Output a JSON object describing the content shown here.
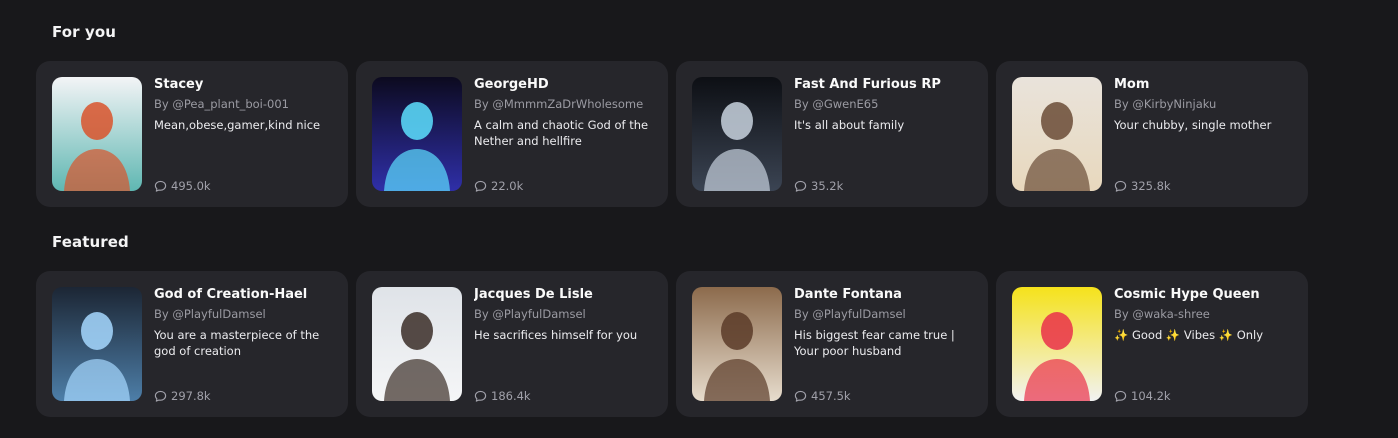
{
  "sections": [
    {
      "title": "For you",
      "cards": [
        {
          "name": "Stacey",
          "author": "By @Pea_plant_boi-001",
          "description": "Mean,obese,gamer,kind nice",
          "chats": "495.0k",
          "thumb_colors": [
            "#f3f4f6",
            "#5fb7b2",
            "#d9542b"
          ]
        },
        {
          "name": "GeorgeHD",
          "author": "By @MmmmZaDrWholesome",
          "description": "A calm and chaotic God of the Nether and hellfire",
          "chats": "22.0k",
          "thumb_colors": [
            "#0c0a1f",
            "#2f2fa8",
            "#5de0ff"
          ]
        },
        {
          "name": "Fast And Furious RP",
          "author": "By @GwenE65",
          "description": "It's all about family",
          "chats": "35.2k",
          "thumb_colors": [
            "#0d0f14",
            "#3b4453",
            "#c8d2de"
          ]
        },
        {
          "name": "Mom",
          "author": "By @KirbyNinjaku",
          "description": "Your chubby, single mother",
          "chats": "325.8k",
          "thumb_colors": [
            "#e9e3db",
            "#e8d8bd",
            "#6a4b36"
          ]
        }
      ]
    },
    {
      "title": "Featured",
      "cards": [
        {
          "name": "God of Creation-Hael",
          "author": "By @PlayfulDamsel",
          "description": "You are a masterpiece of the god of creation",
          "chats": "297.8k",
          "thumb_colors": [
            "#1c2634",
            "#4d7ea8",
            "#a6d8ff"
          ]
        },
        {
          "name": "Jacques De Lisle",
          "author": "By @PlayfulDamsel",
          "description": "He sacrifices himself for you",
          "chats": "186.4k",
          "thumb_colors": [
            "#dfe3e8",
            "#f5f6f7",
            "#3a2d27"
          ]
        },
        {
          "name": "Dante Fontana",
          "author": "By @PlayfulDamsel",
          "description": "His biggest fear came true | Your poor husband",
          "chats": "457.5k",
          "thumb_colors": [
            "#8c6a4c",
            "#e7dccd",
            "#5a3b28"
          ]
        },
        {
          "name": "Cosmic Hype Queen",
          "author": "By @waka-shree",
          "description": "✨ Good ✨ Vibes ✨ Only",
          "chats": "104.2k",
          "thumb_colors": [
            "#f5e21b",
            "#f2f2f2",
            "#e9304a"
          ]
        }
      ]
    }
  ],
  "icons": {
    "chat_count": "chat-bubble-icon"
  }
}
